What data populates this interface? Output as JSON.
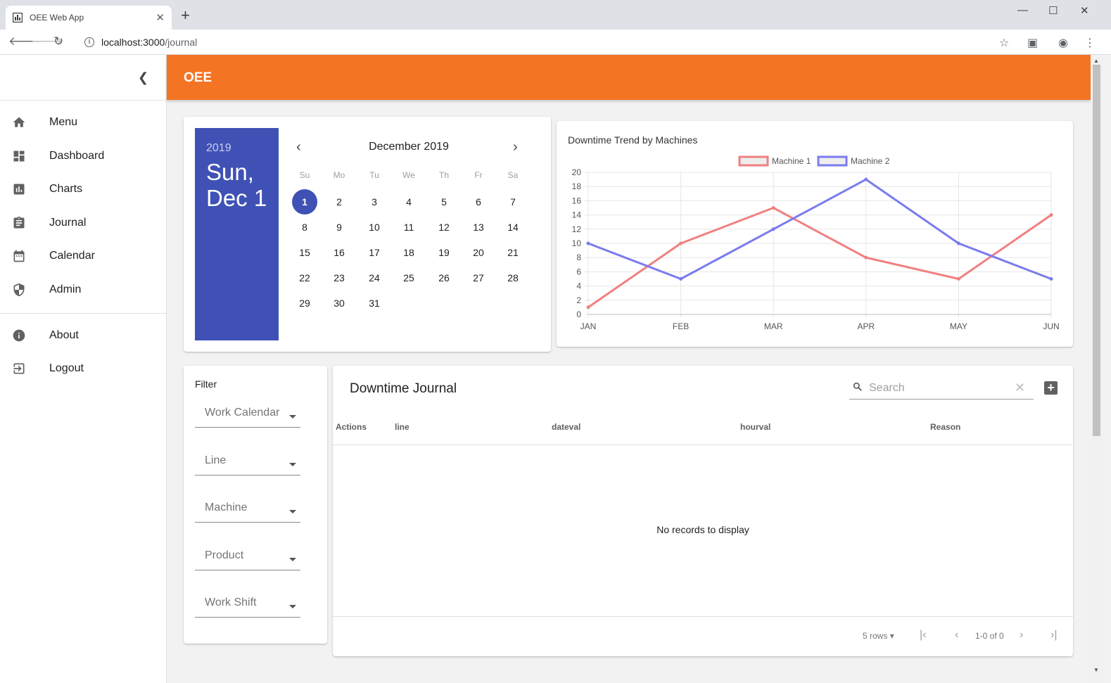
{
  "browser": {
    "tab_title": "OEE Web App",
    "tab_close": "✕",
    "new_tab": "+",
    "url_host": "localhost:3000",
    "url_path": "/journal"
  },
  "app": {
    "title": "OEE"
  },
  "sidebar": {
    "items": [
      {
        "label": "Menu",
        "icon": "home-icon"
      },
      {
        "label": "Dashboard",
        "icon": "dashboard-icon"
      },
      {
        "label": "Charts",
        "icon": "bar-chart-icon"
      },
      {
        "label": "Journal",
        "icon": "clipboard-icon"
      },
      {
        "label": "Calendar",
        "icon": "calendar-icon"
      },
      {
        "label": "Admin",
        "icon": "shield-icon"
      },
      {
        "label": "About",
        "icon": "info-icon"
      },
      {
        "label": "Logout",
        "icon": "logout-icon"
      }
    ]
  },
  "calendar": {
    "year": "2019",
    "selected_label_line1": "Sun,",
    "selected_label_line2": "Dec 1",
    "month_label": "December 2019",
    "weekdays": [
      "Su",
      "Mo",
      "Tu",
      "We",
      "Th",
      "Fr",
      "Sa"
    ],
    "days_in_month": 31,
    "first_weekday": 0,
    "selected_day": 1
  },
  "chart_data": {
    "type": "line",
    "title": "Downtime Trend by Machines",
    "categories": [
      "JAN",
      "FEB",
      "MAR",
      "APR",
      "MAY",
      "JUN"
    ],
    "series": [
      {
        "name": "Machine 1",
        "color": "#f08080",
        "values": [
          1,
          10,
          15,
          8,
          5,
          14
        ]
      },
      {
        "name": "Machine 2",
        "color": "#7b7bef",
        "values": [
          10,
          5,
          12,
          19,
          10,
          5
        ]
      }
    ],
    "ylim": [
      0,
      20
    ],
    "yticks": [
      "0",
      "2",
      "4",
      "6",
      "8",
      "10",
      "12",
      "14",
      "16",
      "18",
      "20"
    ],
    "grid": true,
    "legend": "top"
  },
  "filter": {
    "title": "Filter",
    "fields": [
      "Work Calendar",
      "Line",
      "Machine",
      "Product",
      "Work Shift"
    ]
  },
  "journal": {
    "title": "Downtime Journal",
    "search_placeholder": "Search",
    "columns": [
      "Actions",
      "line",
      "dateval",
      "hourval",
      "Reason"
    ],
    "empty_text": "No records to display",
    "rows_label": "5 rows",
    "page_info": "1-0 of 0"
  }
}
